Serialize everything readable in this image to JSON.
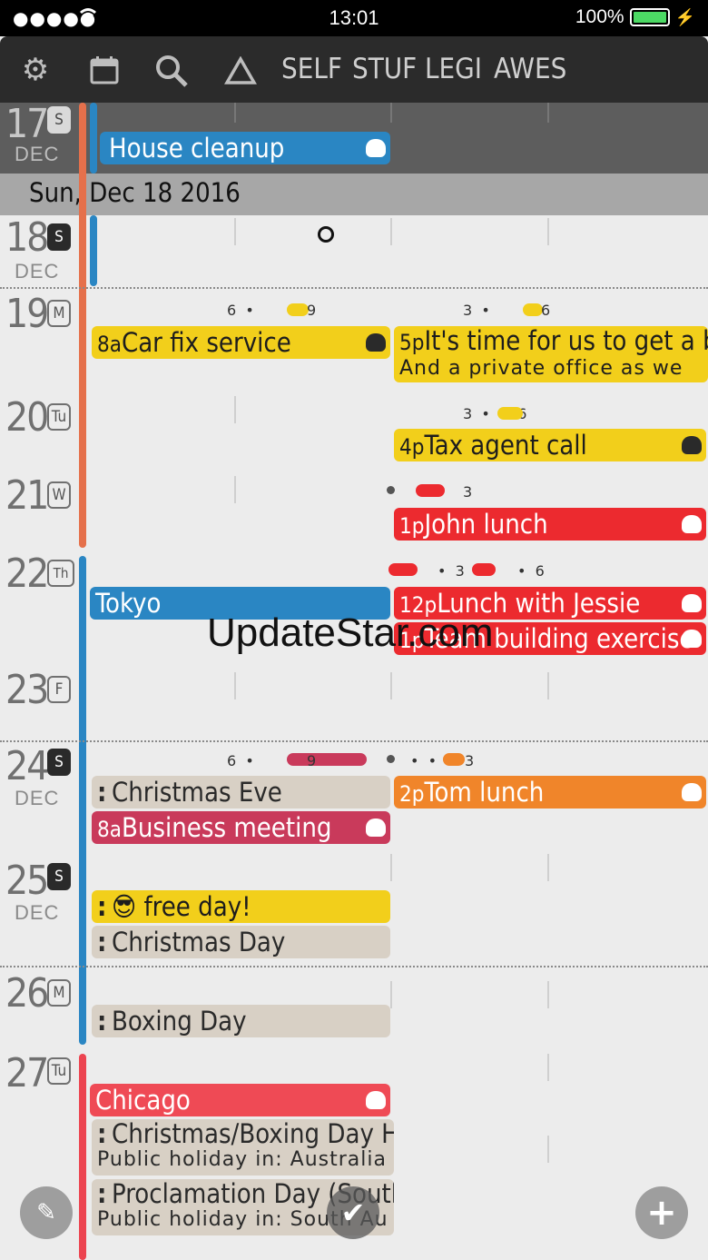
{
  "status_bar": {
    "signal": "●●●●● ",
    "wifi": "wifi",
    "time": "13:01",
    "battery": "100%"
  },
  "toolbar": {
    "icons": [
      "gear-icon",
      "calendar-icon",
      "search-icon",
      "triangle-icon"
    ],
    "filters": [
      "SELF",
      "STUF",
      "LEGI",
      "AWES"
    ]
  },
  "prev_day": {
    "num": "17",
    "weekday": "S",
    "month": "DEC",
    "event": "House cleanup"
  },
  "date_header": "Sun, Dec 18 2016",
  "days": [
    {
      "num": "18",
      "weekday": "S",
      "month": "DEC"
    },
    {
      "num": "19",
      "weekday": "M"
    },
    {
      "num": "20",
      "weekday": "Tu"
    },
    {
      "num": "21",
      "weekday": "W"
    },
    {
      "num": "22",
      "weekday": "Th"
    },
    {
      "num": "23",
      "weekday": "F"
    },
    {
      "num": "24",
      "weekday": "S",
      "month": "DEC"
    },
    {
      "num": "25",
      "weekday": "S",
      "month": "DEC"
    },
    {
      "num": "26",
      "weekday": "M"
    },
    {
      "num": "27",
      "weekday": "Tu"
    }
  ],
  "hour_markers": {
    "d19_left": "6  •  ",
    "d19_left_end": "9",
    "d19_right": "3  •  ",
    "d19_right_end": "6",
    "d20_right": "3  •      6",
    "d21_right": "3",
    "d22_right": "•  3",
    "d22_right_end": "•  6",
    "d24_left": "6  •",
    "d24_left_mid": "9",
    "d24_right": "•  •",
    "d24_right_end": "3"
  },
  "events": {
    "car_fix": {
      "time": "8a",
      "title": "Car fix service"
    },
    "office": {
      "time": "5p",
      "title": "It's time for us to get a bu",
      "sub": "And a private office as we"
    },
    "tax": {
      "time": "4p",
      "title": "Tax agent call"
    },
    "john": {
      "time": "1p",
      "title": "John lunch"
    },
    "tokyo": {
      "title": "Tokyo"
    },
    "jessie": {
      "time": "12p",
      "title": "Lunch with Jessie"
    },
    "team": {
      "time": "1p",
      "title": "Team building exercise"
    },
    "christmas_eve": {
      "title": "Christmas Eve"
    },
    "tom": {
      "time": "2p",
      "title": "Tom lunch"
    },
    "business": {
      "time": "8a",
      "title": "Business meeting"
    },
    "free_day": {
      "title": "😎 free day!"
    },
    "christmas_day": {
      "title": "Christmas Day"
    },
    "boxing_day": {
      "title": "Boxing Day"
    },
    "chicago": {
      "title": "Chicago"
    },
    "xmas_boxing": {
      "title": "Christmas/Boxing Day H",
      "sub": "Public holiday in: Australia"
    },
    "proclamation": {
      "title": "Proclamation Day (South",
      "sub": "Public holiday in: South Au"
    }
  },
  "watermark": "UpdateStar.com",
  "fabs": {
    "edit": "✎",
    "done": "✔",
    "add": "+"
  },
  "colors": {
    "yellow": "#f2cf1b",
    "red": "#ec2a2f",
    "blue": "#2a86c3",
    "orange": "#f0852a",
    "crimson": "#c93a5b",
    "tan": "#d8d0c5"
  }
}
